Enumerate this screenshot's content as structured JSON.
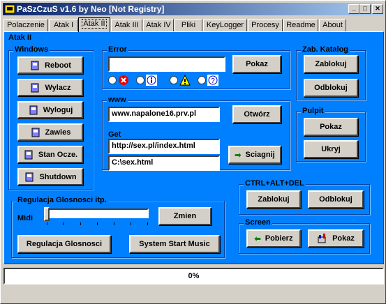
{
  "window": {
    "title": "PaSzCzuS v1.6 by Neo [Not Registry]"
  },
  "tabs": [
    "Polaczenie",
    "Atak I",
    "Atak II",
    "Atak III",
    "Atak IV",
    "Pliki",
    "KeyLogger",
    "Procesy",
    "Readme",
    "About"
  ],
  "active_tab": "Atak II",
  "panel_title": "Atak II",
  "windows_group": {
    "title": "Windows",
    "buttons": [
      "Reboot",
      "Wylacz",
      "Wyloguj",
      "Zawies",
      "Stan Ocze.",
      "Shutdown"
    ]
  },
  "error_group": {
    "title": "Error",
    "input_value": "",
    "show_button": "Pokaz"
  },
  "www_group": {
    "title": "www",
    "url_value": "www.napalone16.prv.pl",
    "open_button": "Otwórz",
    "get_label": "Get",
    "get_url": "http://sex.pl/index.html",
    "save_path": "C:\\sex.html",
    "download_button": "Sciagnij"
  },
  "catalog_group": {
    "title": "Zab. Katalog",
    "lock": "Zablokuj",
    "unlock": "Odblokuj"
  },
  "desktop_group": {
    "title": "Pulpit",
    "show": "Pokaz",
    "hide": "Ukryj"
  },
  "cad_group": {
    "title": "CTRL+ALT+DEL",
    "lock": "Zablokuj",
    "unlock": "Odblokuj"
  },
  "screen_group": {
    "title": "Screen",
    "get": "Pobierz",
    "show": "Pokaz"
  },
  "volume_group": {
    "title": "Regulacja Glosnosci itp.",
    "midi_label": "Midi",
    "midi_level": 0,
    "change_button": "Zmien",
    "volume_button": "Regulacja Glosnosci",
    "music_button": "System Start Music"
  },
  "status": {
    "progress": "0%"
  }
}
